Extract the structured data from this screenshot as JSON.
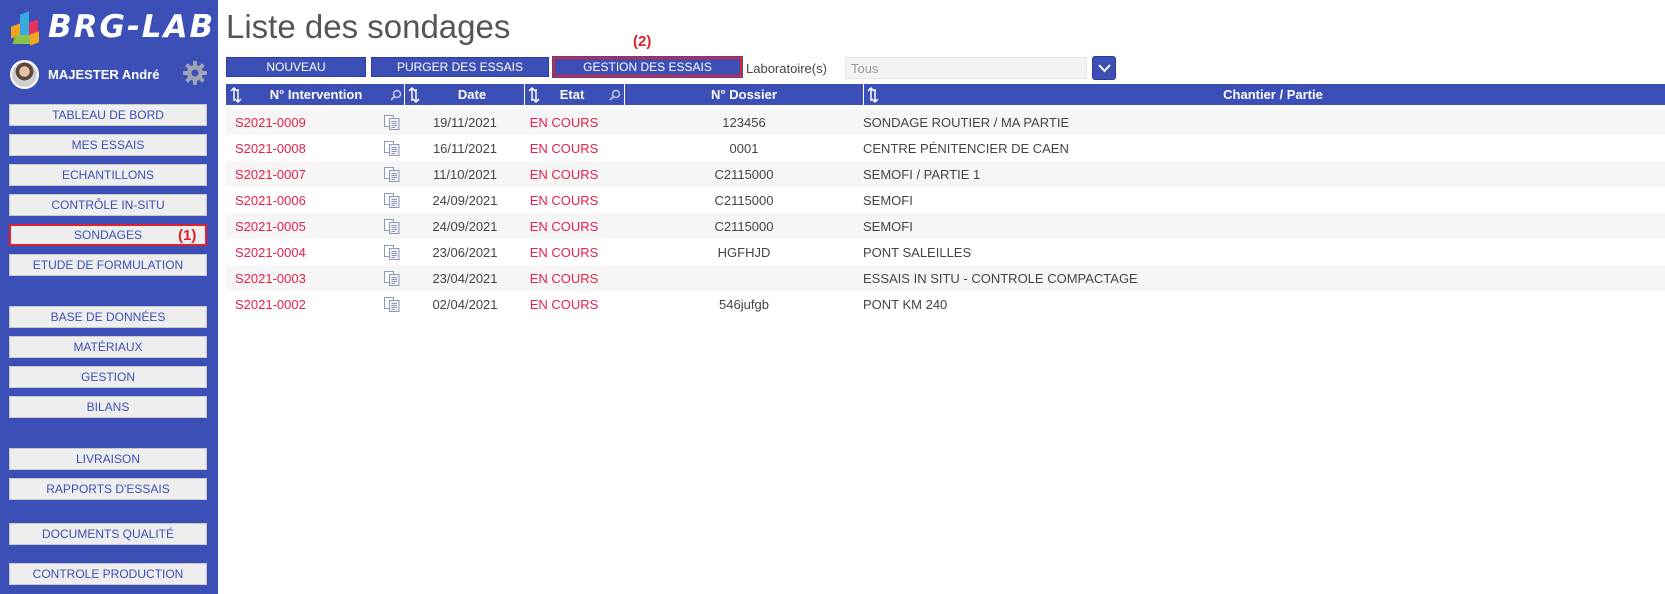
{
  "app": {
    "logo_text": "BRG-LAB",
    "user_name": "MAJESTER André",
    "accent": "#3c4fb6",
    "link_red": "#e8204c",
    "annotation_red": "#e0202a"
  },
  "sidebar": {
    "groups": [
      [
        "TABLEAU DE BORD",
        "MES ESSAIS",
        "ECHANTILLONS",
        "CONTRÔLE IN-SITU",
        "SONDAGES",
        "ETUDE DE FORMULATION"
      ],
      [
        "BASE DE DONNÉES",
        "MATÉRIAUX",
        "GESTION",
        "BILANS"
      ],
      [
        "LIVRAISON",
        "RAPPORTS D'ESSAIS"
      ],
      [
        "DOCUMENTS QUALITÉ"
      ],
      [
        "CONTROLE PRODUCTION"
      ]
    ],
    "active": "SONDAGES",
    "annotation": "(1)"
  },
  "main": {
    "title": "Liste des sondages",
    "buttons": [
      "NOUVEAU",
      "PURGER DES ESSAIS",
      "GESTION DES ESSAIS"
    ],
    "annotation": "(2)",
    "laboratoire_label": "Laboratoire(s)",
    "laboratoire_value": "Tous"
  },
  "table": {
    "headers": [
      "N° Intervention",
      "Date",
      "Etat",
      "N° Dossier",
      "Chantier / Partie"
    ],
    "rows": [
      {
        "id": "S2021-0009",
        "date": "19/11/2021",
        "etat": "EN COURS",
        "dossier": "123456",
        "chantier": "SONDAGE ROUTIER / MA PARTIE"
      },
      {
        "id": "S2021-0008",
        "date": "16/11/2021",
        "etat": "EN COURS",
        "dossier": "0001",
        "chantier": "CENTRE PÉNITENCIER DE CAEN"
      },
      {
        "id": "S2021-0007",
        "date": "11/10/2021",
        "etat": "EN COURS",
        "dossier": "C2115000",
        "chantier": "SEMOFI / PARTIE 1"
      },
      {
        "id": "S2021-0006",
        "date": "24/09/2021",
        "etat": "EN COURS",
        "dossier": "C2115000",
        "chantier": "SEMOFI"
      },
      {
        "id": "S2021-0005",
        "date": "24/09/2021",
        "etat": "EN COURS",
        "dossier": "C2115000",
        "chantier": "SEMOFI"
      },
      {
        "id": "S2021-0004",
        "date": "23/06/2021",
        "etat": "EN COURS",
        "dossier": "HGFHJD",
        "chantier": "PONT SALEILLES"
      },
      {
        "id": "S2021-0003",
        "date": "23/04/2021",
        "etat": "EN COURS",
        "dossier": "",
        "chantier": "ESSAIS IN SITU - CONTROLE COMPACTAGE"
      },
      {
        "id": "S2021-0002",
        "date": "02/04/2021",
        "etat": "EN COURS",
        "dossier": "546jufgb",
        "chantier": "PONT KM 240"
      }
    ]
  }
}
